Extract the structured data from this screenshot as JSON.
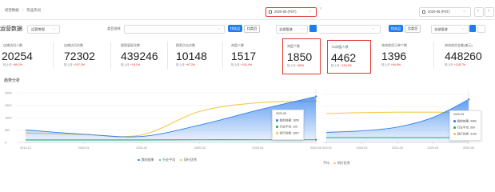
{
  "breadcrumb": {
    "root": "经营数据",
    "sep": "/",
    "current": "热品热词"
  },
  "date_picker_main": {
    "value": "2020-05 (PST)"
  },
  "date_picker_right": {
    "value": "2020-05 (PST)"
  },
  "toolbar": {
    "section_title": "运营数据",
    "scope_select": "运营常规",
    "category_label": "类目选择",
    "btn_primary": "找选品",
    "btn_secondary": "比类目",
    "channel_select": "全部投放",
    "btn_primary_right": "找选品",
    "btn_secondary_right": "比类目",
    "channel_select_right": "全部投放"
  },
  "cards": [
    {
      "label": "店铺访问人数",
      "value": "20254",
      "sub": "较上月",
      "change": "+89.2%"
    },
    {
      "label": "店铺访问次数",
      "value": "72302",
      "sub": "较上月",
      "change": "+107.3%"
    },
    {
      "label": "搜索展现次数",
      "value": "439246",
      "sub": "较上月",
      "change": "+19.1%"
    },
    {
      "label": "搜索点击次数",
      "value": "10148",
      "sub": "较上月",
      "change": "+97.2%"
    },
    {
      "label": "询盘人数",
      "value": "1517",
      "sub": "较上月",
      "change": "+101.4%"
    },
    {
      "label": "询盘个数",
      "value": "1850",
      "sub": "较上月",
      "change": "+80%"
    }
  ],
  "cards_right": [
    {
      "label": "TM询盘人数",
      "value": "4462",
      "sub": "较上月",
      "change": "+115.3%"
    },
    {
      "label": "询询收货订单个数",
      "value": "1396",
      "sub": "较上月",
      "change": "+64.6%"
    },
    {
      "label": "询询收货金额(美元)",
      "value": "448260",
      "sub": "较上月",
      "change": "+126.7%"
    }
  ],
  "trend": {
    "title": "趋势分析"
  },
  "chart_data": [
    {
      "type": "area",
      "x": [
        "2019-12",
        "2020-01",
        "2020-02",
        "2020-03",
        "2020-04",
        "2020-05"
      ],
      "ylim": [
        0,
        2000
      ],
      "yticks": [
        "2000",
        "1500",
        "1000",
        "500",
        "0"
      ],
      "series": [
        {
          "name": "我的效果",
          "color": "#2f80ed",
          "values": [
            500,
            330,
            240,
            700,
            1300,
            1850
          ]
        },
        {
          "name": "行业平均",
          "color": "#27ae60",
          "values": [
            100,
            100,
            100,
            105,
            105,
            105
          ]
        },
        {
          "name": "同行优秀",
          "color": "#f2c94c",
          "values": [
            380,
            320,
            300,
            1250,
            1600,
            1660
          ]
        }
      ],
      "tooltip": {
        "date": "2020-05",
        "rows": [
          {
            "label": "我的效果",
            "value": "1850"
          },
          {
            "label": "行业平均",
            "value": "105"
          },
          {
            "label": "同行优秀",
            "value": "1667"
          }
        ]
      }
    },
    {
      "type": "area",
      "x": [
        "2020-01",
        "2020-02",
        "2020-03",
        "2020-04",
        "2020-05"
      ],
      "series": [
        {
          "name": "我的效果",
          "color": "#2f80ed",
          "values": [
            1050,
            1200,
            1600,
            2600,
            4462
          ]
        },
        {
          "name": "行业平均",
          "color": "#27ae60",
          "values": [
            500,
            500,
            500,
            500,
            500
          ]
        },
        {
          "name": "同行优秀",
          "color": "#f2c94c",
          "values": [
            3000,
            3100,
            3150,
            3150,
            3130
          ]
        }
      ],
      "tooltip": {
        "date": "2020-05",
        "rows": [
          {
            "label": "我的效果",
            "value": "4462"
          },
          {
            "label": "行业平均",
            "value": "500"
          },
          {
            "label": "同行优秀",
            "value": "3130"
          }
        ]
      }
    }
  ],
  "legend": [
    {
      "name": "我的效果",
      "color": "#2f80ed"
    },
    {
      "name": "行业平均",
      "color": "#27ae60"
    },
    {
      "name": "同行优秀",
      "color": "#f2c94c"
    }
  ],
  "legend_right": [
    {
      "name": "平均"
    },
    {
      "name": "同行优秀",
      "color": "#f2c94c"
    }
  ]
}
